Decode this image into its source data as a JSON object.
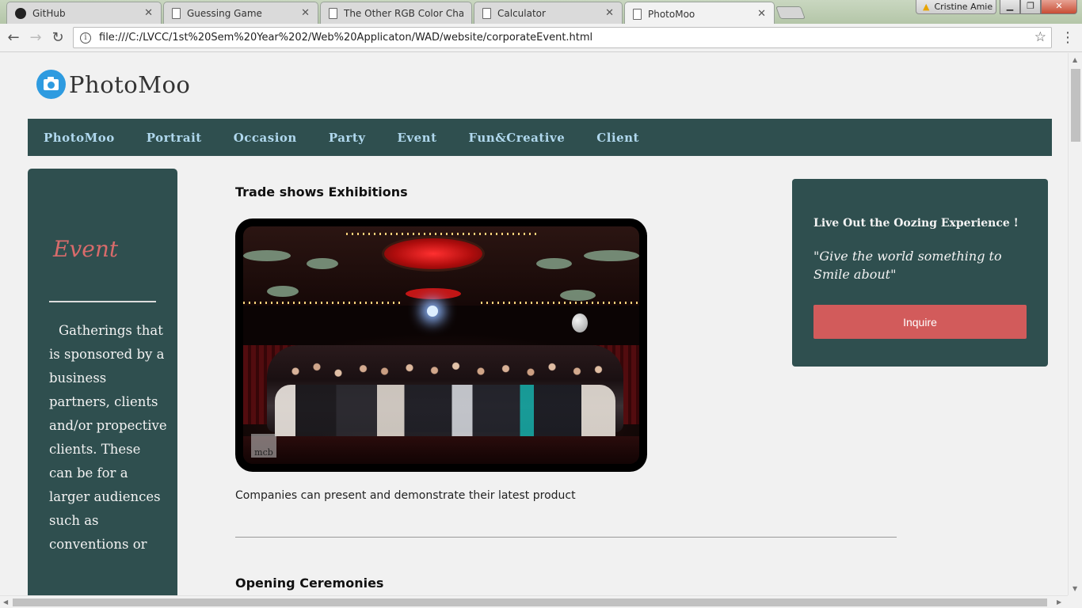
{
  "browser": {
    "tabs": [
      {
        "title": "GitHub",
        "icon": "github-icon"
      },
      {
        "title": "Guessing Game",
        "icon": "page-icon"
      },
      {
        "title": "The Other RGB Color Cha",
        "icon": "page-icon"
      },
      {
        "title": "Calculator",
        "icon": "page-icon"
      },
      {
        "title": "PhotoMoo",
        "icon": "page-icon",
        "active": true
      }
    ],
    "profile_name": "Cristine Amie",
    "url": "file:///C:/LVCC/1st%20Sem%20Year%202/Web%20Applicaton/WAD/website/corporateEvent.html"
  },
  "site": {
    "logo_text": "PhotoMoo",
    "nav": [
      "PhotoMoo",
      "Portrait",
      "Occasion",
      "Party",
      "Event",
      "Fun&Creative",
      "Client"
    ]
  },
  "sidebar": {
    "heading": "Event",
    "text": "Gatherings that is sponsored by a business partners, clients and/or propective clients. These can be for a larger audiences such as conventions or"
  },
  "content": {
    "section1_title": "Trade shows Exhibitions",
    "photo_watermark": "mcb",
    "section1_caption": "Companies can present and demonstrate their latest product",
    "section2_title": "Opening Ceremonies"
  },
  "promo": {
    "title": "Live Out the Oozing Experience !",
    "quote": "\"Give the world something to Smile about\"",
    "button_label": "Inquire"
  },
  "colors": {
    "nav_bg": "#2f4f4f",
    "nav_link": "#b0d8ee",
    "accent_heading": "#d86b6b",
    "button": "#d25b5b",
    "page_bg": "#f1f1f1"
  }
}
